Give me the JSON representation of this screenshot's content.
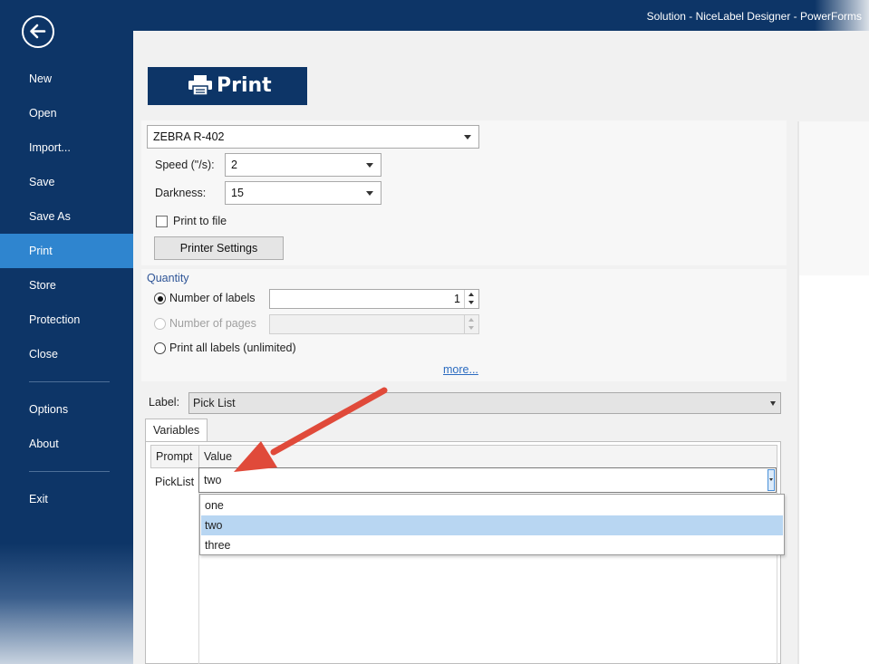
{
  "window": {
    "title": "Solution - NiceLabel Designer - PowerForms"
  },
  "sidebar": {
    "items": [
      {
        "label": "New"
      },
      {
        "label": "Open"
      },
      {
        "label": "Import..."
      },
      {
        "label": "Save"
      },
      {
        "label": "Save As"
      },
      {
        "label": "Print"
      },
      {
        "label": "Store"
      },
      {
        "label": "Protection"
      },
      {
        "label": "Close"
      },
      {
        "label": "Options"
      },
      {
        "label": "About"
      },
      {
        "label": "Exit"
      }
    ],
    "active": "Print"
  },
  "print_header": {
    "label": "Print",
    "icon": "printer-icon"
  },
  "printer": {
    "selected": "ZEBRA R-402",
    "speed_label": "Speed (\"/s):",
    "speed_value": "2",
    "darkness_label": "Darkness:",
    "darkness_value": "15",
    "print_to_file_label": "Print to file",
    "print_to_file_checked": false,
    "settings_button": "Printer Settings"
  },
  "quantity": {
    "title": "Quantity",
    "number_of_labels_label": "Number of labels",
    "number_of_labels_value": "1",
    "number_of_pages_label": "Number of pages",
    "print_all_label": "Print all labels (unlimited)",
    "selected": "Number of labels",
    "more_link": "more..."
  },
  "label_select": {
    "label": "Label:",
    "value": "Pick List"
  },
  "variables": {
    "tab_label": "Variables",
    "columns": [
      "Prompt",
      "Value"
    ],
    "rows": [
      {
        "prompt": "PickList",
        "value": "two"
      }
    ],
    "dropdown_options": [
      "one",
      "two",
      "three"
    ],
    "dropdown_selected": "two"
  },
  "colors": {
    "navy": "#0d3567",
    "active_nav": "#2f85cf",
    "arrow": "#e04a3a",
    "selection": "#b8d6f2",
    "link": "#2b6bc0"
  }
}
